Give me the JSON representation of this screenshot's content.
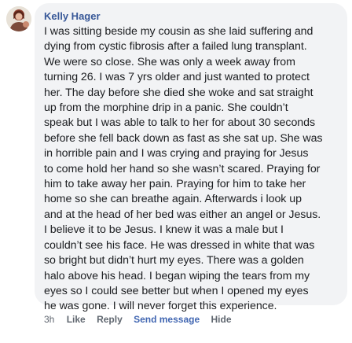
{
  "comment": {
    "author": "Kelly Hager",
    "text": "I was sitting beside my cousin as she laid suffering and\ndying from cystic fibrosis after a failed lung transplant.\nWe were so close. She was only a week away from\nturning 26. I was 7 yrs older and just wanted to protect\nher. The day before she died she woke and sat straight\nup from the morphine drip in a panic. She couldn’t\nspeak but I was able to talk to her for about 30 seconds\nbefore she fell back down as fast as she sat up. She was\nin horrible pain and I was crying and praying for Jesus\nto come hold her hand so she wasn’t scared. Praying for\nhim to take away her pain. Praying for him to take her\nhome so she can breathe again. Afterwards i look up\nand at the head of her bed was either an angel or Jesus.\nI believe it to be Jesus. I knew it was a male but I\ncouldn’t see his face. He was dressed in white that was\nso bright but didn’t hurt my eyes. There was a golden\nhalo above his head. I began wiping the tears from my\neyes so I could see better but when I opened my eyes\nhe was gone. I will never forget this experience.",
    "avatar_icon": "profile-photo"
  },
  "actions": {
    "timestamp": "3h",
    "like": "Like",
    "reply": "Reply",
    "send_message": "Send message",
    "hide": "Hide"
  },
  "colors": {
    "author": "#385898",
    "text": "#1c1e21",
    "bubble": "#f2f3f5",
    "meta": "#606770",
    "accent": "#4267b2"
  }
}
